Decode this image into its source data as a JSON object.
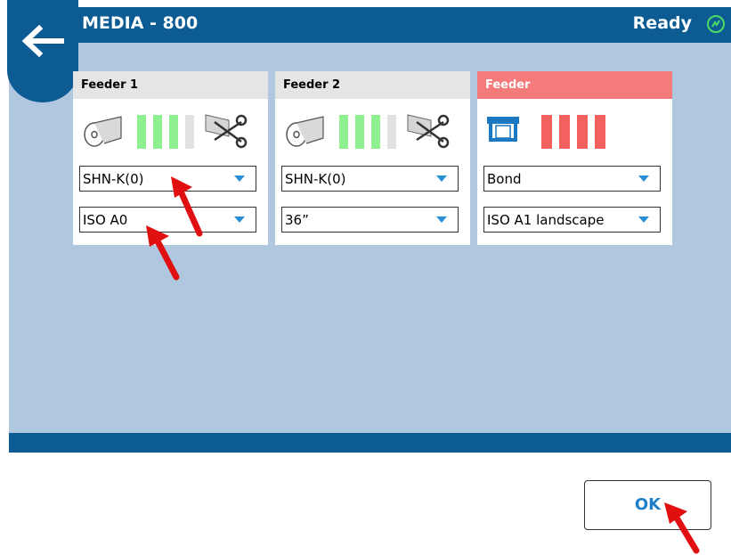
{
  "header": {
    "title": "MEDIA - 800",
    "status": "Ready"
  },
  "feeders": [
    {
      "name": "Feeder 1",
      "media_type": "SHN-K(0)",
      "media_size": "ISO A0",
      "alert": false
    },
    {
      "name": "Feeder 2",
      "media_type": "SHN-K(0)",
      "media_size": "36”",
      "alert": false
    },
    {
      "name": "Feeder",
      "media_type": "Bond",
      "media_size": "ISO A1 landscape",
      "alert": true
    }
  ],
  "footer": {
    "ok_label": "OK"
  },
  "icons": [
    "back-arrow-icon",
    "ready-status-icon",
    "roll-icon",
    "cutter-icon",
    "tray-icon"
  ],
  "colors": {
    "brand": "#0c5b93",
    "panel_bg": "#b0c7e0",
    "level_full": "#8ef08e",
    "level_empty": "#e2e2e2",
    "alert": "#f57a7a",
    "accent": "#1e7fc8"
  }
}
